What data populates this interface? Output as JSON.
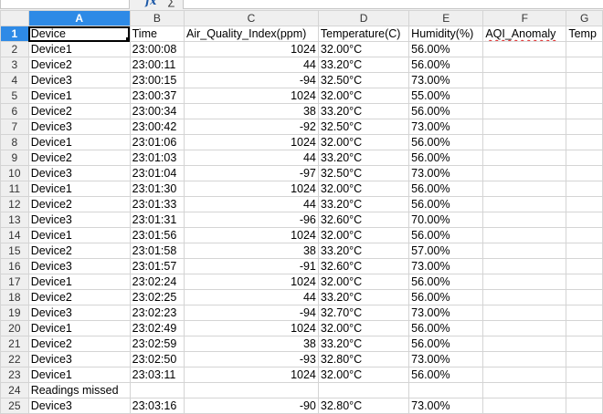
{
  "formula_bar": {
    "name_box": "",
    "fx_icon": "fx-icon",
    "sum_icon": "sum-icon",
    "formula": ""
  },
  "columns": [
    "A",
    "B",
    "C",
    "D",
    "E",
    "F",
    "G"
  ],
  "selected_column": "A",
  "selected_row": 1,
  "rows": [
    {
      "n": "1",
      "cells": [
        "Device",
        "Time",
        "Air_Quality_Index(ppm)",
        "Temperature(C)",
        "Humidity(%)",
        "AQI_Anomaly",
        "Temp"
      ]
    },
    {
      "n": "2",
      "cells": [
        "Device1",
        "23:00:08",
        "1024",
        "32.00°C",
        "56.00%",
        "",
        ""
      ]
    },
    {
      "n": "3",
      "cells": [
        "Device2",
        "23:00:11",
        "44",
        "33.20°C",
        "56.00%",
        "",
        ""
      ]
    },
    {
      "n": "4",
      "cells": [
        "Device3",
        "23:00:15",
        "-94",
        "32.50°C",
        "73.00%",
        "",
        ""
      ]
    },
    {
      "n": "5",
      "cells": [
        "Device1",
        "23:00:37",
        "1024",
        "32.00°C",
        "55.00%",
        "",
        ""
      ]
    },
    {
      "n": "6",
      "cells": [
        "Device2",
        "23:00:34",
        "38",
        "33.20°C",
        "56.00%",
        "",
        ""
      ]
    },
    {
      "n": "7",
      "cells": [
        "Device3",
        "23:00:42",
        "-92",
        "32.50°C",
        "73.00%",
        "",
        ""
      ]
    },
    {
      "n": "8",
      "cells": [
        "Device1",
        "23:01:06",
        "1024",
        "32.00°C",
        "56.00%",
        "",
        ""
      ]
    },
    {
      "n": "9",
      "cells": [
        "Device2",
        "23:01:03",
        "44",
        "33.20°C",
        "56.00%",
        "",
        ""
      ]
    },
    {
      "n": "10",
      "cells": [
        "Device3",
        "23:01:04",
        "-97",
        "32.50°C",
        "73.00%",
        "",
        ""
      ]
    },
    {
      "n": "11",
      "cells": [
        "Device1",
        "23:01:30",
        "1024",
        "32.00°C",
        "56.00%",
        "",
        ""
      ]
    },
    {
      "n": "12",
      "cells": [
        "Device2",
        "23:01:33",
        "44",
        "33.20°C",
        "56.00%",
        "",
        ""
      ]
    },
    {
      "n": "13",
      "cells": [
        "Device3",
        "23:01:31",
        "-96",
        "32.60°C",
        "70.00%",
        "",
        ""
      ]
    },
    {
      "n": "14",
      "cells": [
        "Device1",
        "23:01:56",
        "1024",
        "32.00°C",
        "56.00%",
        "",
        ""
      ]
    },
    {
      "n": "15",
      "cells": [
        "Device2",
        "23:01:58",
        "38",
        "33.20°C",
        "57.00%",
        "",
        ""
      ]
    },
    {
      "n": "16",
      "cells": [
        "Device3",
        "23:01:57",
        "-91",
        "32.60°C",
        "73.00%",
        "",
        ""
      ]
    },
    {
      "n": "17",
      "cells": [
        "Device1",
        "23:02:24",
        "1024",
        "32.00°C",
        "56.00%",
        "",
        ""
      ]
    },
    {
      "n": "18",
      "cells": [
        "Device2",
        "23:02:25",
        "44",
        "33.20°C",
        "56.00%",
        "",
        ""
      ]
    },
    {
      "n": "19",
      "cells": [
        "Device3",
        "23:02:23",
        "-94",
        "32.70°C",
        "73.00%",
        "",
        ""
      ]
    },
    {
      "n": "20",
      "cells": [
        "Device1",
        "23:02:49",
        "1024",
        "32.00°C",
        "56.00%",
        "",
        ""
      ]
    },
    {
      "n": "21",
      "cells": [
        "Device2",
        "23:02:59",
        "38",
        "33.20°C",
        "56.00%",
        "",
        ""
      ]
    },
    {
      "n": "22",
      "cells": [
        "Device3",
        "23:02:50",
        "-93",
        "32.80°C",
        "73.00%",
        "",
        ""
      ]
    },
    {
      "n": "23",
      "cells": [
        "Device1",
        "23:03:11",
        "1024",
        "32.00°C",
        "56.00%",
        "",
        ""
      ]
    },
    {
      "n": "24",
      "cells": [
        "Readings missed",
        "",
        "",
        "",
        "",
        "",
        ""
      ]
    },
    {
      "n": "25",
      "cells": [
        "Device3",
        "23:03:16",
        "-90",
        "32.80°C",
        "73.00%",
        "",
        ""
      ]
    }
  ],
  "colors": {
    "selection": "#2e8ae6",
    "header_bg": "#efefef",
    "grid": "#d4d4d4"
  }
}
